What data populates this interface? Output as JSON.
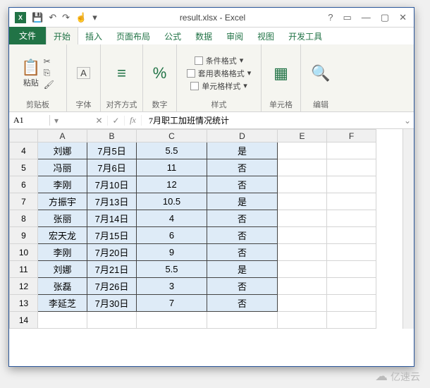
{
  "title": "result.xlsx - Excel",
  "titlebar_controls": {
    "help": "?",
    "ribbon_toggle": "▭",
    "minimize": "—",
    "restore": "▢",
    "close": "✕"
  },
  "tabs": {
    "file": "文件",
    "home": "开始",
    "insert": "插入",
    "layout": "页面布局",
    "formulas": "公式",
    "data": "数据",
    "review": "审阅",
    "view": "视图",
    "dev": "开发工具"
  },
  "ribbon": {
    "paste": "粘贴",
    "clipboard": "剪贴板",
    "font": "字体",
    "align": "对齐方式",
    "number": "数字",
    "cond_format": "条件格式",
    "table_format": "套用表格格式",
    "cell_style": "单元格样式",
    "styles": "样式",
    "cells": "单元格",
    "editing": "编辑"
  },
  "formula_bar": {
    "namebox": "A1",
    "fx": "fx",
    "content": "7月职工加班情况统计"
  },
  "columns": [
    "A",
    "B",
    "C",
    "D",
    "E",
    "F"
  ],
  "rows": [
    {
      "n": 4,
      "hl": "cyan",
      "a": "刘娜",
      "b": "7月5日",
      "c": "5.5",
      "d": "是"
    },
    {
      "n": 5,
      "hl": "yellow",
      "a": "冯丽",
      "b": "7月6日",
      "c": "11",
      "d": "否"
    },
    {
      "n": 6,
      "hl": "cyan",
      "a": "李刚",
      "b": "7月10日",
      "c": "12",
      "d": "否"
    },
    {
      "n": 7,
      "hl": "yellow",
      "a": "方振宇",
      "b": "7月13日",
      "c": "10.5",
      "d": "是"
    },
    {
      "n": 8,
      "hl": "cyan",
      "a": "张丽",
      "b": "7月14日",
      "c": "4",
      "d": "否"
    },
    {
      "n": 9,
      "hl": "yellow",
      "a": "宏天龙",
      "b": "7月15日",
      "c": "6",
      "d": "否"
    },
    {
      "n": 10,
      "hl": "cyan",
      "a": "李刚",
      "b": "7月20日",
      "c": "9",
      "d": "否"
    },
    {
      "n": 11,
      "hl": "cyan",
      "a": "刘娜",
      "b": "7月21日",
      "c": "5.5",
      "d": "是"
    },
    {
      "n": 12,
      "hl": "yellow",
      "a": "张磊",
      "b": "7月26日",
      "c": "3",
      "d": "否"
    },
    {
      "n": 13,
      "hl": "cyan",
      "a": "李延芝",
      "b": "7月30日",
      "c": "7",
      "d": "否"
    },
    {
      "n": 14,
      "hl": "",
      "a": "",
      "b": "",
      "c": "",
      "d": ""
    }
  ],
  "watermark": "亿速云"
}
